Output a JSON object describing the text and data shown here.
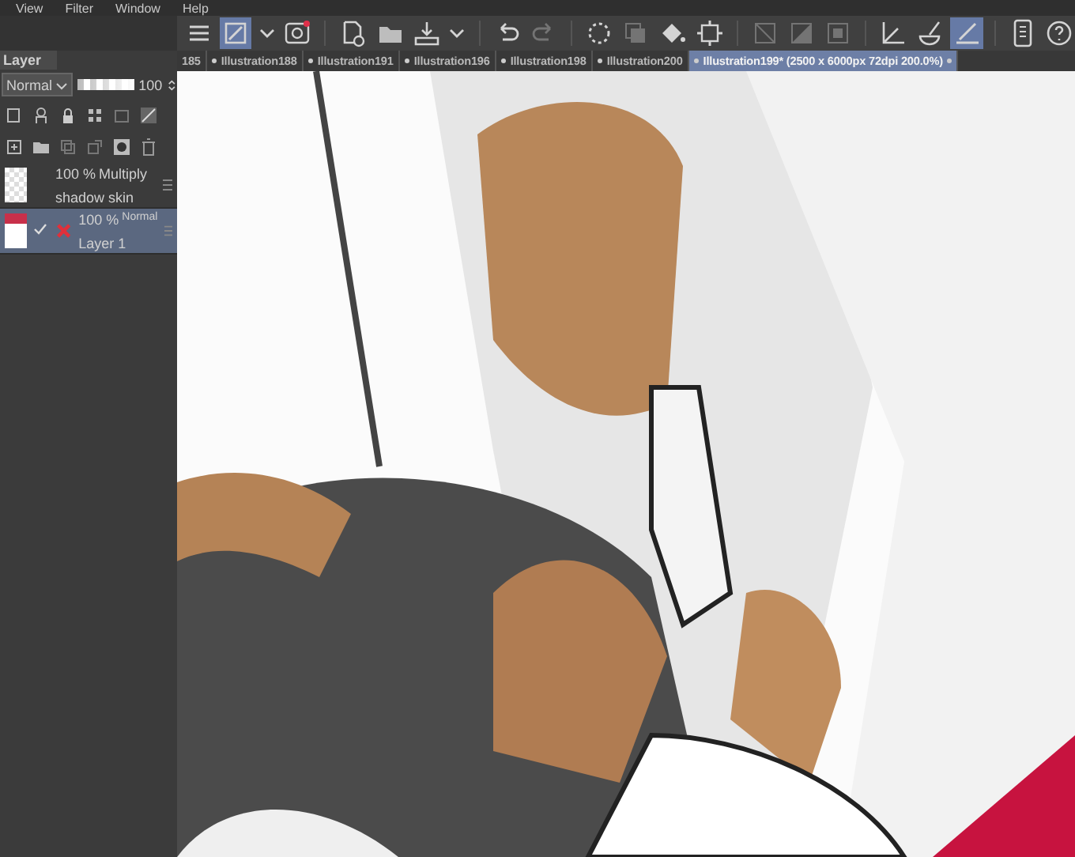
{
  "menu": [
    "View",
    "Filter",
    "Window",
    "Help"
  ],
  "toolbar": [
    [
      {
        "kind": "menu",
        "selected": false,
        "disabled": false
      },
      {
        "kind": "pen-tool",
        "selected": true,
        "disabled": false
      },
      {
        "kind": "chevron",
        "selected": false,
        "disabled": false
      },
      {
        "kind": "companion",
        "selected": false,
        "disabled": false
      }
    ],
    [
      {
        "kind": "new",
        "selected": false,
        "disabled": false
      },
      {
        "kind": "open",
        "selected": false,
        "disabled": false
      },
      {
        "kind": "export",
        "selected": false,
        "disabled": false
      },
      {
        "kind": "chevron",
        "selected": false,
        "disabled": false
      }
    ],
    [
      {
        "kind": "undo",
        "selected": false,
        "disabled": false
      },
      {
        "kind": "redo",
        "selected": false,
        "disabled": true
      }
    ],
    [
      {
        "kind": "lasso",
        "selected": false,
        "disabled": false
      },
      {
        "kind": "copy",
        "selected": false,
        "disabled": true
      },
      {
        "kind": "fill",
        "selected": false,
        "disabled": false
      },
      {
        "kind": "transform",
        "selected": false,
        "disabled": false
      }
    ],
    [
      {
        "kind": "clear",
        "selected": false,
        "disabled": true
      },
      {
        "kind": "gradient",
        "selected": false,
        "disabled": true
      },
      {
        "kind": "square",
        "selected": false,
        "disabled": true
      }
    ],
    [
      {
        "kind": "ruler",
        "selected": false,
        "disabled": false
      },
      {
        "kind": "brush-ruler",
        "selected": false,
        "disabled": false
      },
      {
        "kind": "ruler-pen",
        "selected": true,
        "disabled": false
      }
    ],
    [
      {
        "kind": "phone",
        "selected": false,
        "disabled": false
      },
      {
        "kind": "help",
        "selected": false,
        "disabled": false
      }
    ]
  ],
  "tabs": [
    {
      "label": "185",
      "selected": false
    },
    {
      "label": "Illustration188",
      "selected": false
    },
    {
      "label": "Illustration191",
      "selected": false
    },
    {
      "label": "Illustration196",
      "selected": false
    },
    {
      "label": "Illustration198",
      "selected": false
    },
    {
      "label": "Illustration200",
      "selected": false
    },
    {
      "label": "Illustration199* (2500 x 6000px 72dpi 200.0%)",
      "selected": true
    }
  ],
  "layer_panel": {
    "title": "Layer",
    "blend_mode": "Normal",
    "opacity": {
      "level": 1,
      "reading": "100"
    },
    "layers": [
      {
        "opacity": "100 %",
        "mode": "Multiply",
        "name": "shadow skin",
        "selected": false,
        "visible": false,
        "excluded": false
      },
      {
        "opacity": "100 %",
        "mode": "Normal",
        "name": "Layer 1",
        "selected": true,
        "visible": true,
        "excluded": true
      }
    ]
  },
  "canvas": {
    "kind": "picture"
  }
}
